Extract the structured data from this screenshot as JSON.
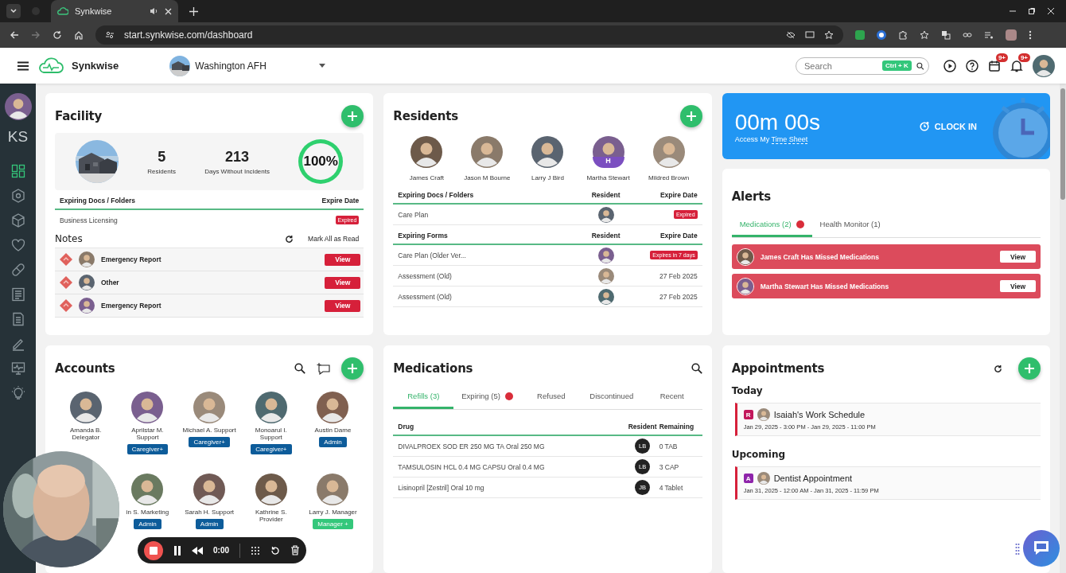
{
  "browser": {
    "tab_title": "Synkwise",
    "url": "start.synkwise.com/dashboard"
  },
  "header": {
    "brand": "Synkwise",
    "facility": "Washington AFH",
    "search": {
      "placeholder": "Search",
      "shortcut": "Ctrl + K"
    },
    "calendar_badge": "9+",
    "bell_badge": "9+"
  },
  "sidebar": {
    "initials": "KS",
    "items": [
      {
        "kind": "grid",
        "selected": true
      },
      {
        "kind": "hexagon",
        "selected": false
      },
      {
        "kind": "box",
        "selected": false
      },
      {
        "kind": "heart",
        "selected": false
      },
      {
        "kind": "pill",
        "selected": false
      },
      {
        "kind": "list",
        "selected": false
      },
      {
        "kind": "document",
        "selected": false
      },
      {
        "kind": "pen",
        "selected": false
      },
      {
        "kind": "monitor",
        "selected": false
      },
      {
        "kind": "bulb",
        "selected": false
      }
    ]
  },
  "facility": {
    "title": "Facility",
    "stats": [
      {
        "value": "5",
        "label": "Residents"
      },
      {
        "value": "213",
        "label": "Days Without Incidents"
      }
    ],
    "score": {
      "text": "100%",
      "level": 1
    },
    "docs": {
      "columns": [
        "Expiring Docs / Folders",
        "Expire Date"
      ],
      "rows": [
        {
          "name": "Business Licensing",
          "status": "Expired"
        }
      ]
    },
    "notes": {
      "title": "Notes",
      "action": "Mark All as Read",
      "items": [
        {
          "title": "Emergency Report",
          "button": "View"
        },
        {
          "title": "Other",
          "button": "View"
        },
        {
          "title": "Emergency Report",
          "button": "View"
        }
      ]
    }
  },
  "residents": {
    "title": "Residents",
    "people": [
      {
        "name": "James Craft"
      },
      {
        "name": "Jason M Bourne"
      },
      {
        "name": "Larry J Bird"
      },
      {
        "name": "Martha Stewart",
        "badge": "H"
      },
      {
        "name": "Mildred Brown"
      }
    ],
    "docs": {
      "columns": [
        "Expiring Docs / Folders",
        "Resident",
        "Expire Date"
      ],
      "rows": [
        {
          "name": "Care Plan",
          "kind": "badge",
          "expiry": "Expired"
        }
      ]
    },
    "forms": {
      "columns": [
        "Expiring Forms",
        "Resident",
        "Expire Date"
      ],
      "rows": [
        {
          "name": "Care Plan (Older Ver...",
          "kind": "badge",
          "expiry": "Expires in 7 days"
        },
        {
          "name": "Assessment (Old)",
          "kind": "date",
          "expiry": "27 Feb 2025"
        },
        {
          "name": "Assessment (Old)",
          "kind": "date",
          "expiry": "27 Feb 2025"
        }
      ]
    }
  },
  "timer": {
    "time": "00m 00s",
    "caption": "Access My",
    "link": "Time Sheet",
    "action": "CLOCK IN"
  },
  "alerts": {
    "title": "Alerts",
    "tabs": [
      {
        "label": "Medications (2)",
        "selected": true,
        "dot": true
      },
      {
        "label": "Health Monitor (1)",
        "selected": false,
        "dot": false
      }
    ],
    "items": [
      {
        "text": "James Craft Has Missed Medications",
        "button": "View"
      },
      {
        "text": "Martha Stewart Has Missed Medications",
        "button": "View"
      }
    ]
  },
  "accounts": {
    "title": "Accounts",
    "people": [
      {
        "name": "Amanda B. Delegator"
      },
      {
        "name": "Aprilstar M. Support",
        "role": {
          "text": "Caregiver+",
          "color": "#0d5c9a"
        }
      },
      {
        "name": "Michael A. Support",
        "role": {
          "text": "Caregiver+",
          "color": "#0d5c9a"
        }
      },
      {
        "name": "Monoarul I. Support",
        "role": {
          "text": "Caregiver+",
          "color": "#0d5c9a"
        }
      },
      {
        "name": "Austin Dame",
        "role": {
          "text": "Admin",
          "color": "#0d5c9a"
        }
      },
      {
        "name": "in S. Marketing",
        "role": {
          "text": "Admin",
          "color": "#0d5c9a"
        }
      },
      {
        "name": "Sarah H. Support",
        "role": {
          "text": "Admin",
          "color": "#0d5c9a"
        }
      },
      {
        "name": "Kathrine S. Provider"
      },
      {
        "name": "Larry J. Manager",
        "role": {
          "text": "Manager +",
          "color": "#34c77b"
        }
      }
    ]
  },
  "medications": {
    "title": "Medications",
    "tabs": [
      {
        "label": "Refills (3)",
        "selected": true,
        "dot": false
      },
      {
        "label": "Expiring (5)",
        "selected": false,
        "dot": true
      },
      {
        "label": "Refused",
        "selected": false,
        "dot": false
      },
      {
        "label": "Discontinued",
        "selected": false,
        "dot": false
      },
      {
        "label": "Recent",
        "selected": false,
        "dot": false
      }
    ],
    "columns": [
      "Drug",
      "Resident",
      "Remaining"
    ],
    "rows": [
      {
        "drug": "DIVALPROEX SOD ER 250 MG TA Oral 250 MG",
        "resident": "LB",
        "remaining": "0 TAB"
      },
      {
        "drug": "TAMSULOSIN HCL 0.4 MG CAPSU Oral 0.4 MG",
        "resident": "LB",
        "remaining": "3 CAP"
      },
      {
        "drug": "Lisinopril [Zestril] Oral 10 mg",
        "resident": "JB",
        "remaining": "4 Tablet"
      }
    ]
  },
  "appointments": {
    "title": "Appointments",
    "groups": [
      {
        "label": "Today",
        "items": [
          {
            "tag": "R",
            "color": "#c2185b",
            "title": "Isaiah's Work Schedule",
            "time": "Jan 29, 2025 - 3:00 PM - Jan 29, 2025 - 11:00 PM"
          }
        ]
      },
      {
        "label": "Upcoming",
        "items": [
          {
            "tag": "A",
            "color": "#8e24aa",
            "title": "Dentist Appointment",
            "time": "Jan 31, 2025 - 12:00 AM - Jan 31, 2025 - 11:59 PM"
          }
        ]
      }
    ]
  },
  "recorder": {
    "time": "0:00"
  }
}
